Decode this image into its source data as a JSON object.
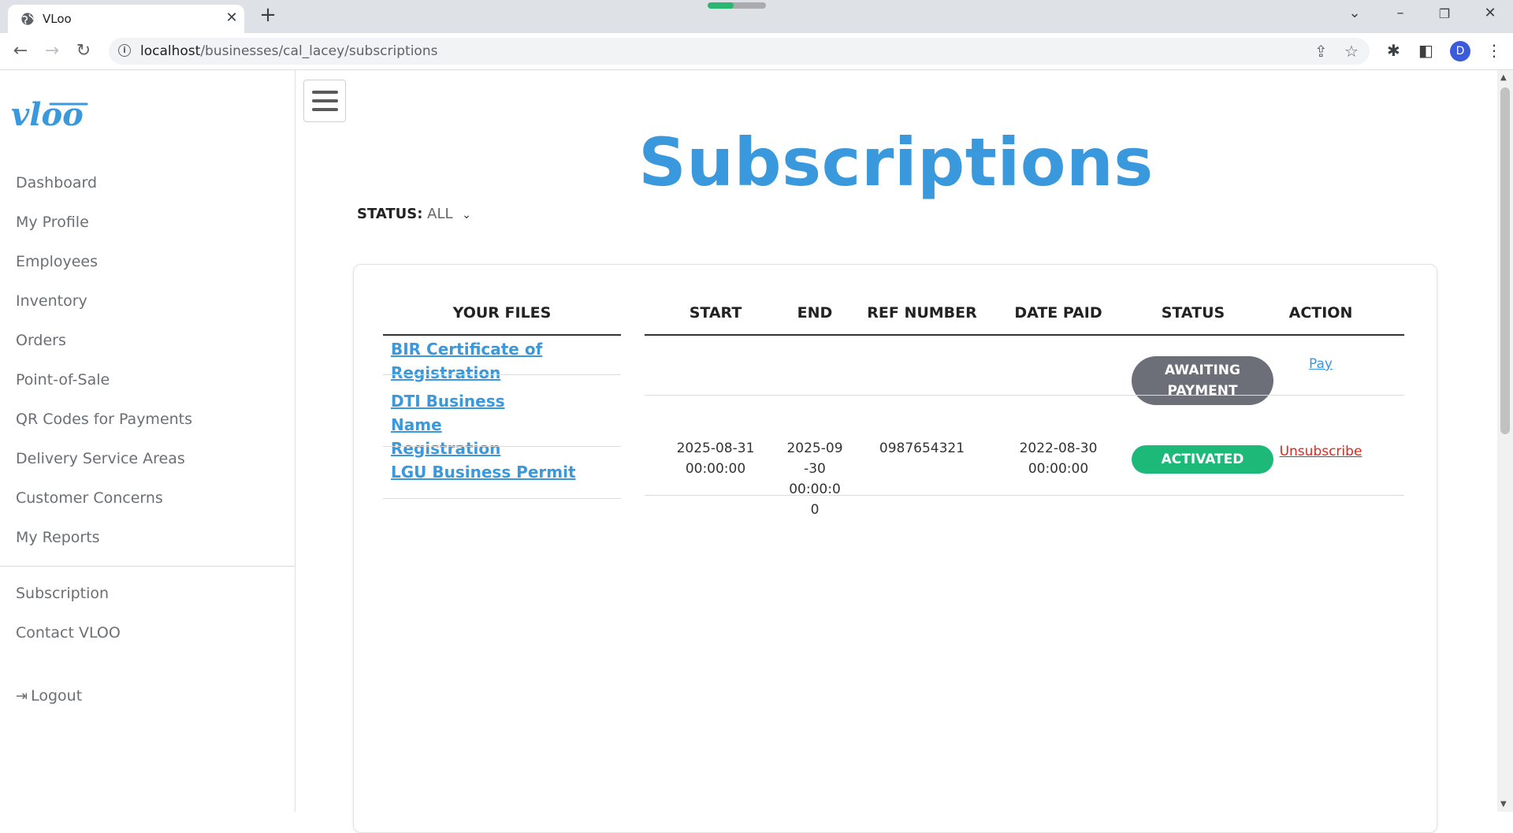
{
  "browser": {
    "tab_title": "VLoo",
    "url_host": "localhost",
    "url_path": "/businesses/cal_lacey/subscriptions",
    "profile_initial": "D",
    "loading_progress": 0.45
  },
  "sidebar": {
    "logo_text": "vloo",
    "nav": [
      {
        "label": "Dashboard"
      },
      {
        "label": "My Profile"
      },
      {
        "label": "Employees"
      },
      {
        "label": "Inventory"
      },
      {
        "label": "Orders"
      },
      {
        "label": "Point-of-Sale"
      },
      {
        "label": "QR Codes for Payments"
      },
      {
        "label": "Delivery Service Areas"
      },
      {
        "label": "Customer Concerns"
      },
      {
        "label": "My Reports"
      }
    ],
    "secondary": [
      {
        "label": "Subscription"
      },
      {
        "label": "Contact VLOO"
      }
    ],
    "logout_label": "Logout"
  },
  "main": {
    "title": "Subscriptions",
    "status_filter": {
      "label": "STATUS:",
      "value": "ALL"
    },
    "files": {
      "header": "YOUR FILES",
      "items": [
        {
          "label": "BIR Certificate of Registration"
        },
        {
          "label": "DTI Business Name Registration"
        },
        {
          "label": "LGU Business Permit"
        }
      ]
    },
    "table": {
      "headers": {
        "start": "START",
        "end": "END",
        "ref": "REF NUMBER",
        "date_paid": "DATE PAID",
        "status": "STATUS",
        "action": "ACTION"
      },
      "rows": [
        {
          "start_date": "",
          "start_time": "",
          "end_date": "",
          "end_time": "",
          "ref": "",
          "paid_date": "",
          "paid_time": "",
          "status_line1": "AWAITING",
          "status_line2": "PAYMENT",
          "status_color": "#6c6f77",
          "action": "Pay",
          "action_color": "#3a98dc"
        },
        {
          "start_date": "2025-08-31",
          "start_time": "00:00:00",
          "end_date": "2025-09-30",
          "end_time": "00:00:00",
          "ref": "0987654321",
          "paid_date": "2022-08-30",
          "paid_time": "00:00:00",
          "status_line1": "ACTIVATED",
          "status_line2": "",
          "status_color": "#1cb979",
          "action": "Unsubscribe",
          "action_color": "#e0261a"
        }
      ]
    }
  },
  "colors": {
    "brand_blue": "#3a98dc",
    "sidebar_text": "#6b6f73"
  }
}
